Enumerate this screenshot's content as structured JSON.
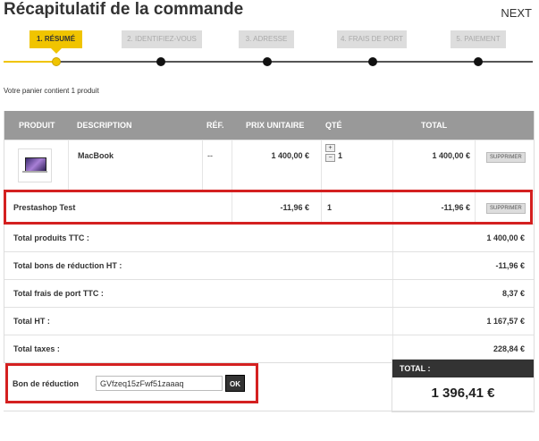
{
  "page": {
    "title": "Récapitulatif de la commande",
    "next": "NEXT"
  },
  "steps": [
    {
      "label": "1. RÉSUMÉ"
    },
    {
      "label": "2. IDENTIFIEZ-VOUS"
    },
    {
      "label": "3. ADRESSE"
    },
    {
      "label": "4. FRAIS DE PORT"
    },
    {
      "label": "5. PAIEMENT"
    }
  ],
  "cart_info": "Votre panier contient 1 produit",
  "table": {
    "headers": {
      "product": "PRODUIT",
      "description": "DESCRIPTION",
      "ref": "RÉF.",
      "unit_price": "PRIX UNITAIRE",
      "qty": "QTÉ",
      "total": "TOTAL"
    },
    "items": [
      {
        "description": "MacBook",
        "ref": "--",
        "unit_price": "1 400,00 €",
        "qty": "1",
        "total": "1 400,00 €",
        "delete": "SUPPRIMER"
      }
    ],
    "discount": {
      "name": "Prestashop Test",
      "unit_price": "-11,96 €",
      "qty": "1",
      "total": "-11,96 €",
      "delete": "SUPPRIMER"
    },
    "qty_up": "+",
    "qty_down": "−"
  },
  "totals": [
    {
      "label": "Total produits TTC :",
      "value": "1 400,00 €"
    },
    {
      "label": "Total bons de réduction HT :",
      "value": "-11,96 €"
    },
    {
      "label": "Total frais de port TTC :",
      "value": "8,37 €"
    },
    {
      "label": "Total HT :",
      "value": "1 167,57 €"
    },
    {
      "label": "Total taxes :",
      "value": "228,84 €"
    }
  ],
  "voucher": {
    "label": "Bon de réduction",
    "value": "GVfzeq15zFwf51zaaaq",
    "button": "OK"
  },
  "grand_total": {
    "label": "TOTAL :",
    "value": "1 396,41 €"
  },
  "colors": {
    "accent": "#f0c400",
    "highlight": "#d42020",
    "header_bg": "#999999"
  }
}
